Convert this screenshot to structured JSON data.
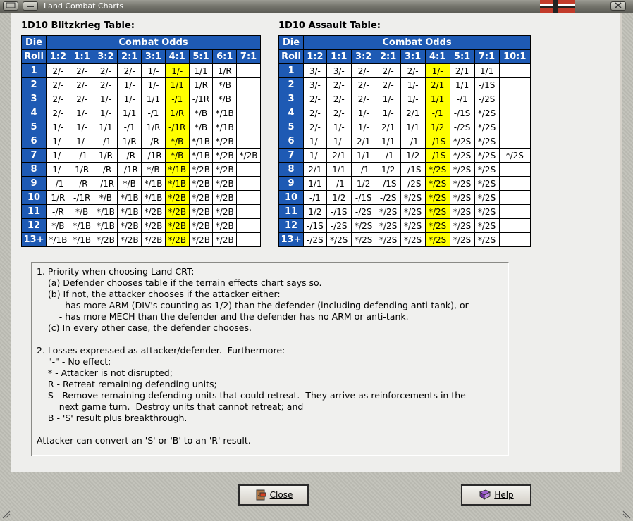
{
  "window": {
    "title": "Land Combat Charts"
  },
  "blitz": {
    "title": "1D10 Blitzkrieg Table:",
    "head_die": "Die",
    "head_odds": "Combat Odds",
    "head_roll": "Roll",
    "odds": [
      "1:2",
      "1:1",
      "3:2",
      "2:1",
      "3:1",
      "4:1",
      "5:1",
      "6:1",
      "7:1"
    ],
    "rows": [
      {
        "roll": "1",
        "cells": [
          "2/-",
          "2/-",
          "2/-",
          "2/-",
          "1/-",
          "1/-",
          "1/1",
          "1/R",
          ""
        ]
      },
      {
        "roll": "2",
        "cells": [
          "2/-",
          "2/-",
          "2/-",
          "1/-",
          "1/-",
          "1/1",
          "1/R",
          "*/B",
          ""
        ]
      },
      {
        "roll": "3",
        "cells": [
          "2/-",
          "2/-",
          "1/-",
          "1/-",
          "1/1",
          "-/1",
          "-/1R",
          "*/B",
          ""
        ]
      },
      {
        "roll": "4",
        "cells": [
          "2/-",
          "1/-",
          "1/-",
          "1/1",
          "-/1",
          "1/R",
          "*/B",
          "*/1B",
          ""
        ]
      },
      {
        "roll": "5",
        "cells": [
          "1/-",
          "1/-",
          "1/1",
          "-/1",
          "1/R",
          "-/1R",
          "*/B",
          "*/1B",
          ""
        ]
      },
      {
        "roll": "6",
        "cells": [
          "1/-",
          "1/-",
          "-/1",
          "1/R",
          "-/R",
          "*/B",
          "*/1B",
          "*/2B",
          ""
        ]
      },
      {
        "roll": "7",
        "cells": [
          "1/-",
          "-/1",
          "1/R",
          "-/R",
          "-/1R",
          "*/B",
          "*/1B",
          "*/2B",
          "*/2B"
        ]
      },
      {
        "roll": "8",
        "cells": [
          "1/-",
          "1/R",
          "-/R",
          "-/1R",
          "*/B",
          "*/1B",
          "*/2B",
          "*/2B",
          ""
        ]
      },
      {
        "roll": "9",
        "cells": [
          "-/1",
          "-/R",
          "-/1R",
          "*/B",
          "*/1B",
          "*/1B",
          "*/2B",
          "*/2B",
          ""
        ]
      },
      {
        "roll": "10",
        "cells": [
          "1/R",
          "-/1R",
          "*/B",
          "*/1B",
          "*/1B",
          "*/2B",
          "*/2B",
          "*/2B",
          ""
        ]
      },
      {
        "roll": "11",
        "cells": [
          "-/R",
          "*/B",
          "*/1B",
          "*/1B",
          "*/2B",
          "*/2B",
          "*/2B",
          "*/2B",
          ""
        ]
      },
      {
        "roll": "12",
        "cells": [
          "*/B",
          "*/1B",
          "*/1B",
          "*/2B",
          "*/2B",
          "*/2B",
          "*/2B",
          "*/2B",
          ""
        ]
      },
      {
        "roll": "13+",
        "cells": [
          "*/1B",
          "*/1B",
          "*/2B",
          "*/2B",
          "*/2B",
          "*/2B",
          "*/2B",
          "*/2B",
          ""
        ]
      }
    ]
  },
  "assault": {
    "title": "1D10 Assault Table:",
    "head_die": "Die",
    "head_odds": "Combat Odds",
    "head_roll": "Roll",
    "odds": [
      "1:2",
      "1:1",
      "3:2",
      "2:1",
      "3:1",
      "4:1",
      "5:1",
      "7:1",
      "10:1"
    ],
    "rows": [
      {
        "roll": "1",
        "cells": [
          "3/-",
          "3/-",
          "2/-",
          "2/-",
          "2/-",
          "1/-",
          "2/1",
          "1/1",
          ""
        ]
      },
      {
        "roll": "2",
        "cells": [
          "3/-",
          "2/-",
          "2/-",
          "2/-",
          "1/-",
          "2/1",
          "1/1",
          "-/1S",
          ""
        ]
      },
      {
        "roll": "3",
        "cells": [
          "2/-",
          "2/-",
          "2/-",
          "1/-",
          "1/-",
          "1/1",
          "-/1",
          "-/2S",
          ""
        ]
      },
      {
        "roll": "4",
        "cells": [
          "2/-",
          "2/-",
          "1/-",
          "1/-",
          "2/1",
          "-/1",
          "-/1S",
          "*/2S",
          ""
        ]
      },
      {
        "roll": "5",
        "cells": [
          "2/-",
          "1/-",
          "1/-",
          "2/1",
          "1/1",
          "1/2",
          "-/2S",
          "*/2S",
          ""
        ]
      },
      {
        "roll": "6",
        "cells": [
          "1/-",
          "1/-",
          "2/1",
          "1/1",
          "-/1",
          "-/1S",
          "*/2S",
          "*/2S",
          ""
        ]
      },
      {
        "roll": "7",
        "cells": [
          "1/-",
          "2/1",
          "1/1",
          "-/1",
          "1/2",
          "-/1S",
          "*/2S",
          "*/2S",
          "*/2S"
        ]
      },
      {
        "roll": "8",
        "cells": [
          "2/1",
          "1/1",
          "-/1",
          "1/2",
          "-/1S",
          "*/2S",
          "*/2S",
          "*/2S",
          ""
        ]
      },
      {
        "roll": "9",
        "cells": [
          "1/1",
          "-/1",
          "1/2",
          "-/1S",
          "-/2S",
          "*/2S",
          "*/2S",
          "*/2S",
          ""
        ]
      },
      {
        "roll": "10",
        "cells": [
          "-/1",
          "1/2",
          "-/1S",
          "-/2S",
          "*/2S",
          "*/2S",
          "*/2S",
          "*/2S",
          ""
        ]
      },
      {
        "roll": "11",
        "cells": [
          "1/2",
          "-/1S",
          "-/2S",
          "*/2S",
          "*/2S",
          "*/2S",
          "*/2S",
          "*/2S",
          ""
        ]
      },
      {
        "roll": "12",
        "cells": [
          "-/1S",
          "-/2S",
          "*/2S",
          "*/2S",
          "*/2S",
          "*/2S",
          "*/2S",
          "*/2S",
          ""
        ]
      },
      {
        "roll": "13+",
        "cells": [
          "-/2S",
          "*/2S",
          "*/2S",
          "*/2S",
          "*/2S",
          "*/2S",
          "*/2S",
          "*/2S",
          ""
        ]
      }
    ]
  },
  "notes": [
    "1. Priority when choosing Land CRT:",
    "    (a) Defender chooses table if the terrain effects chart says so.",
    "    (b) If not, the attacker chooses if the attacker either:",
    "        - has more ARM (DIV's counting as 1/2) than the defender (including defending anti-tank), or",
    "        - has more MECH than the defender and the defender has no ARM or anti-tank.",
    "    (c) In every other case, the defender chooses.",
    "",
    "2. Losses expressed as attacker/defender.  Furthermore:",
    "    \"-\" - No effect;",
    "    * - Attacker is not disrupted;",
    "    R - Retreat remaining defending units;",
    "    S - Remove remaining defending units that could retreat.  They arrive as reinforcements in the",
    "        next game turn.  Destroy units that cannot retreat; and",
    "    B - 'S' result plus breakthrough.",
    "",
    "Attacker can convert an 'S' or 'B' to an 'R' result."
  ],
  "buttons": {
    "close": "Close",
    "help": "Help"
  },
  "colors": {
    "header": "#1e5ab4",
    "highlight": "#ffff00"
  }
}
